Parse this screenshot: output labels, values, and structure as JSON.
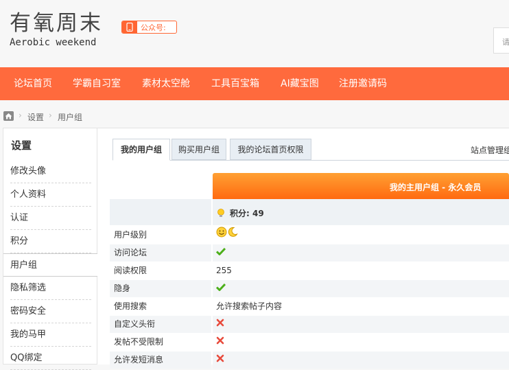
{
  "header": {
    "site_title": "有氧周末",
    "site_subtitle": "Aerobic weekend",
    "wechat_label": "公众号:",
    "search_placeholder": "请"
  },
  "nav": {
    "items": [
      "论坛首页",
      "学霸自习室",
      "素材太空舱",
      "工具百宝箱",
      "AI藏宝图",
      "注册邀请码"
    ]
  },
  "breadcrumb": {
    "items": [
      "设置",
      "用户组"
    ]
  },
  "sidebar": {
    "title": "设置",
    "items": [
      "修改头像",
      "个人资料",
      "认证",
      "积分",
      "用户组",
      "隐私筛选",
      "密码安全",
      "我的马甲",
      "QQ绑定"
    ],
    "active_index": 4
  },
  "main": {
    "tabs": [
      "我的用户组",
      "购买用户组",
      "我的论坛首页权限"
    ],
    "site_admin": "站点管理组",
    "group_header": "我的主用户组 - 永久会员",
    "points": "积分: 49",
    "rows": [
      {
        "label": "用户级别",
        "value": "",
        "icon": "level-icon"
      },
      {
        "label": "访问论坛",
        "value": "",
        "icon": "check-icon"
      },
      {
        "label": "阅读权限",
        "value": "255",
        "icon": ""
      },
      {
        "label": "隐身",
        "value": "",
        "icon": "check-icon"
      },
      {
        "label": "使用搜索",
        "value": "允许搜索帖子内容",
        "icon": ""
      },
      {
        "label": "自定义头衔",
        "value": "",
        "icon": "cross-icon"
      },
      {
        "label": "发帖不受限制",
        "value": "",
        "icon": "cross-icon"
      },
      {
        "label": "允许发短消息",
        "value": "",
        "icon": "cross-icon"
      }
    ]
  },
  "colors": {
    "accent": "#ff6a3d",
    "header_gradient_top": "#ffa033",
    "header_gradient_bottom": "#ff6a10",
    "check": "#4caf1a",
    "cross": "#e84b3c"
  }
}
